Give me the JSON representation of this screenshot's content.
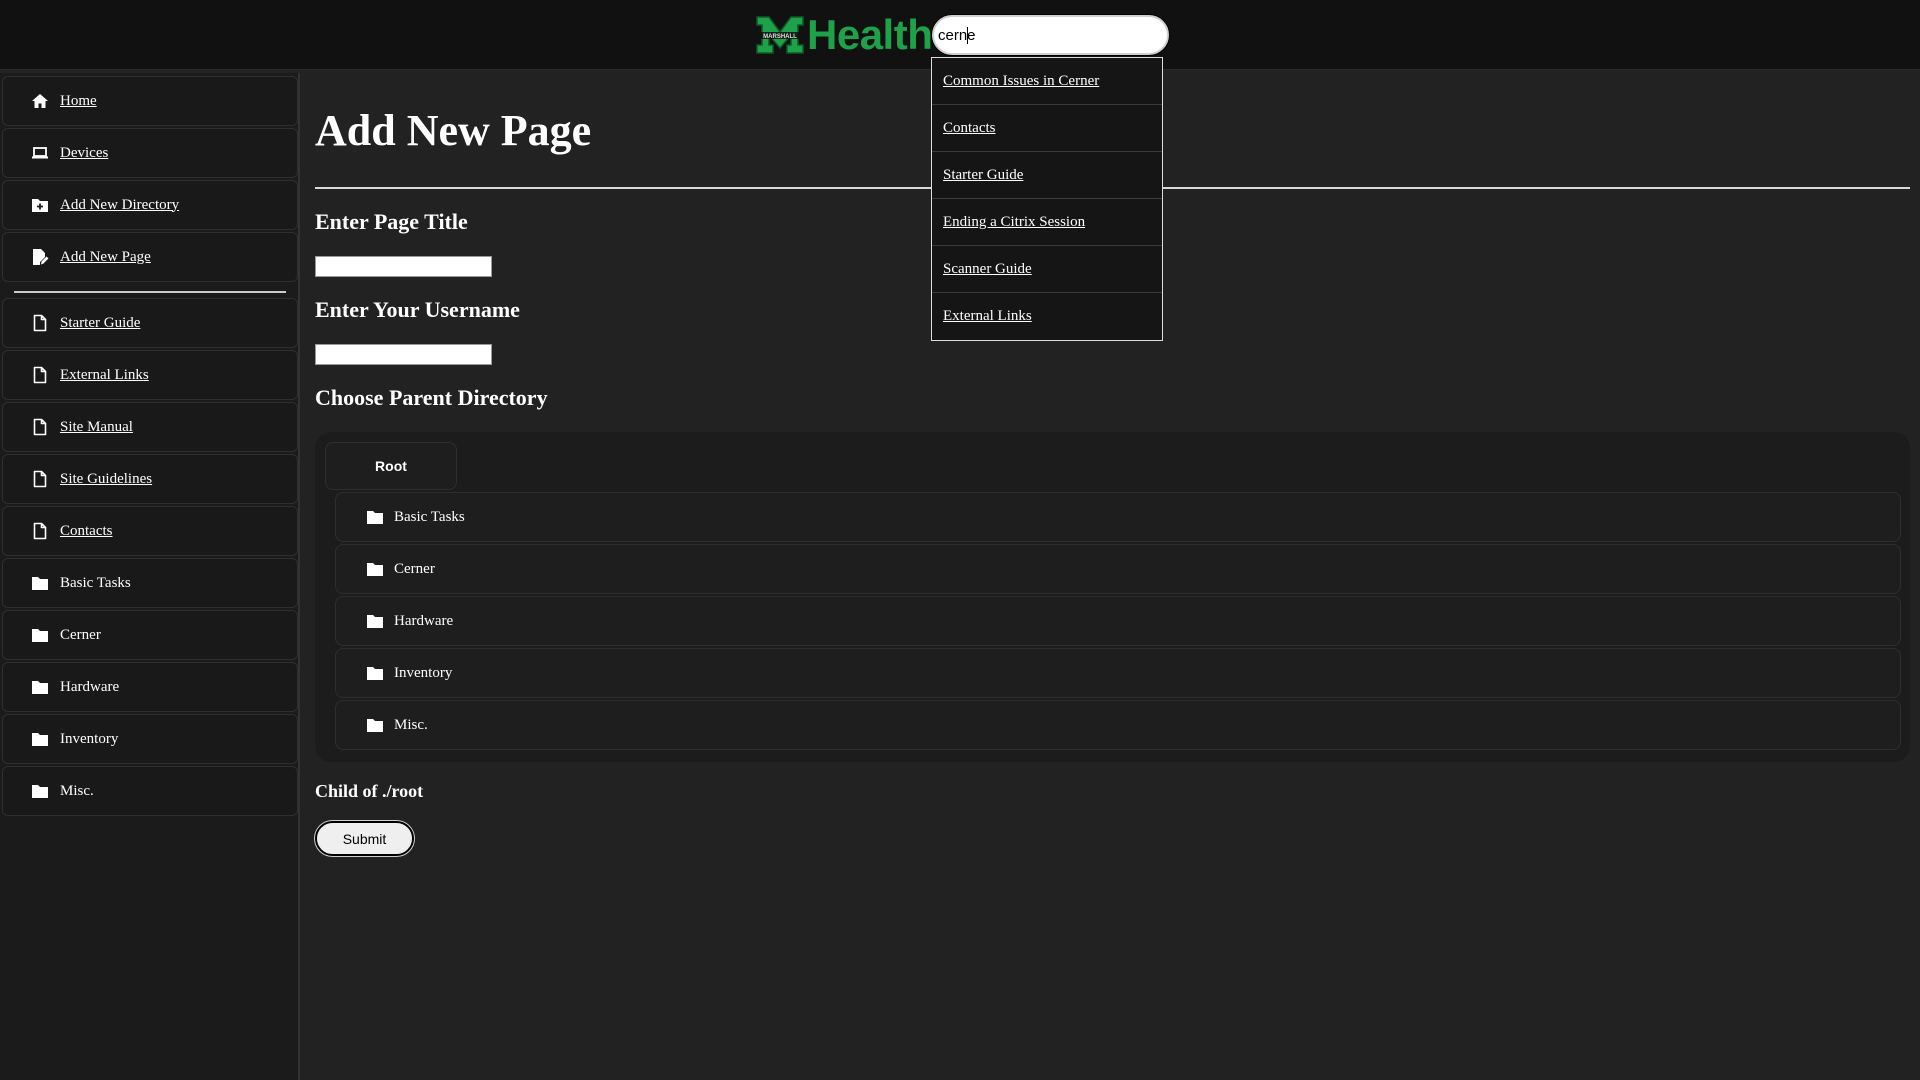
{
  "header": {
    "logo_text": "Health",
    "search": {
      "value": "cerne",
      "placeholder": ""
    }
  },
  "search_results": [
    "Common Issues in Cerner",
    "Contacts",
    "Starter Guide",
    "Ending a Citrix Session",
    "Scanner Guide",
    "External Links"
  ],
  "sidebar": {
    "items": [
      {
        "label": "Home",
        "icon": "home-icon"
      },
      {
        "label": "Devices",
        "icon": "laptop-icon"
      },
      {
        "label": "Add New Directory",
        "icon": "folder-plus-icon"
      },
      {
        "label": "Add New Page",
        "icon": "file-edit-icon"
      },
      {
        "label": "Starter Guide",
        "icon": "file-icon"
      },
      {
        "label": "External Links",
        "icon": "file-icon"
      },
      {
        "label": "Site Manual",
        "icon": "file-icon"
      },
      {
        "label": "Site Guidelines",
        "icon": "file-icon"
      },
      {
        "label": "Contacts",
        "icon": "file-icon"
      },
      {
        "label": "Basic Tasks",
        "icon": "folder-icon"
      },
      {
        "label": "Cerner",
        "icon": "folder-icon"
      },
      {
        "label": "Hardware",
        "icon": "folder-icon"
      },
      {
        "label": "Inventory",
        "icon": "folder-icon"
      },
      {
        "label": "Misc.",
        "icon": "folder-icon"
      }
    ]
  },
  "main": {
    "title": "Add New Page",
    "page_title_label": "Enter Page Title",
    "page_title_value": "",
    "username_label": "Enter Your Username",
    "username_value": "",
    "parent_dir_label": "Choose Parent Directory",
    "directory_tree": {
      "root_label": "Root",
      "children": [
        "Basic Tasks",
        "Cerner",
        "Hardware",
        "Inventory",
        "Misc."
      ]
    },
    "child_of": "Child of ./root",
    "submit_label": "Submit"
  },
  "colors": {
    "brand_green": "#1fa149",
    "background": "#222222",
    "header_bg": "#111111"
  }
}
